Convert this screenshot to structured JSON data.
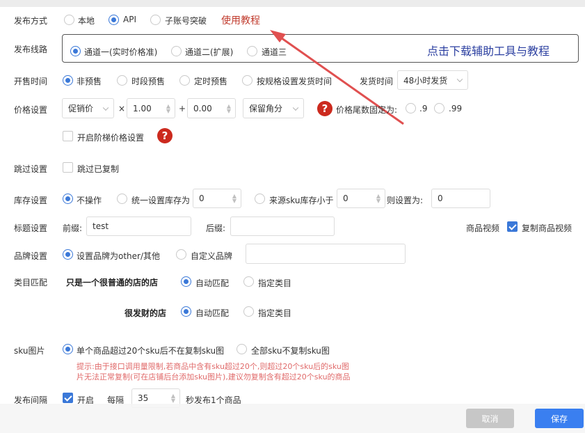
{
  "publish_method": {
    "label": "发布方式",
    "options": [
      "本地",
      "API",
      "子账号突破"
    ],
    "selected": "API",
    "tutorial_link": "使用教程"
  },
  "publish_route": {
    "label": "发布线路",
    "options": [
      "通道一(实时价格准)",
      "通道二(扩展)",
      "通道三"
    ],
    "selected": "通道一(实时价格准)",
    "download_text": "点击下载辅助工具与教程"
  },
  "sale_time": {
    "label": "开售时间",
    "options": [
      "非预售",
      "时段预售",
      "定时预售",
      "按规格设置发货时间"
    ],
    "selected": "非预售",
    "ship_label": "发货时间",
    "ship_value": "48小时发货"
  },
  "price": {
    "label": "价格设置",
    "price_type": "促销价",
    "times": "×",
    "multiplier": "1.00",
    "plus": "+",
    "addend": "0.00",
    "rounding": "保留角分",
    "tail_label": "价格尾数固定为:",
    "tail_options": [
      ".9",
      ".99"
    ],
    "tiered_label": "开启阶梯价格设置",
    "help_glyph": "?"
  },
  "skip": {
    "label": "跳过设置",
    "option": "跳过已复制"
  },
  "stock": {
    "label": "库存设置",
    "opt_none": "不操作",
    "opt_uniform": "统一设置库存为",
    "uniform_value": "0",
    "opt_source": "来源sku库存小于",
    "source_value": "0",
    "then_label": "则设置为:",
    "then_value": "0",
    "selected": "不操作"
  },
  "title": {
    "label": "标题设置",
    "prefix_label": "前缀:",
    "prefix_value": "test",
    "suffix_label": "后缀:",
    "suffix_value": "",
    "video_label": "商品视频",
    "video_checkbox": "复制商品视频"
  },
  "brand": {
    "label": "品牌设置",
    "options": [
      "设置品牌为other/其他",
      "自定义品牌"
    ],
    "selected": "设置品牌为other/其他",
    "custom_value": ""
  },
  "category": {
    "label": "类目匹配",
    "shops": [
      {
        "name": "只是一个很普通的店的店",
        "options": [
          "自动匹配",
          "指定类目"
        ],
        "selected": "自动匹配"
      },
      {
        "name": "很发财的店",
        "options": [
          "自动匹配",
          "指定类目"
        ],
        "selected": "自动匹配"
      }
    ]
  },
  "sku_image": {
    "label": "sku图片",
    "options": [
      "单个商品超过20个sku后不在复制sku图",
      "全部sku不复制sku图"
    ],
    "selected": "单个商品超过20个sku后不在复制sku图",
    "hint_line1": "提示:由于接口调用量限制,若商品中含有sku超过20个,则超过20个sku后的sku图",
    "hint_line2": "片无法正常复制(可在店铺后台添加sku图片),建议勿复制含有超过20个sku的商品"
  },
  "interval": {
    "label": "发布间隔",
    "enable_label": "开启",
    "every_label": "每隔",
    "value": "35",
    "unit": "秒发布1个商品"
  },
  "footer": {
    "cancel": "取消",
    "save": "保存"
  },
  "colors": {
    "accent": "#3a78d8",
    "tutorial_red": "#c0392b",
    "hint_red": "#e06a6a",
    "arrow_red": "#e05050",
    "help_red": "#cc2a1e",
    "download_blue": "#2b3fa0",
    "cancel_bg": "#c7c7c7",
    "save_bg": "#3a7ff0"
  }
}
